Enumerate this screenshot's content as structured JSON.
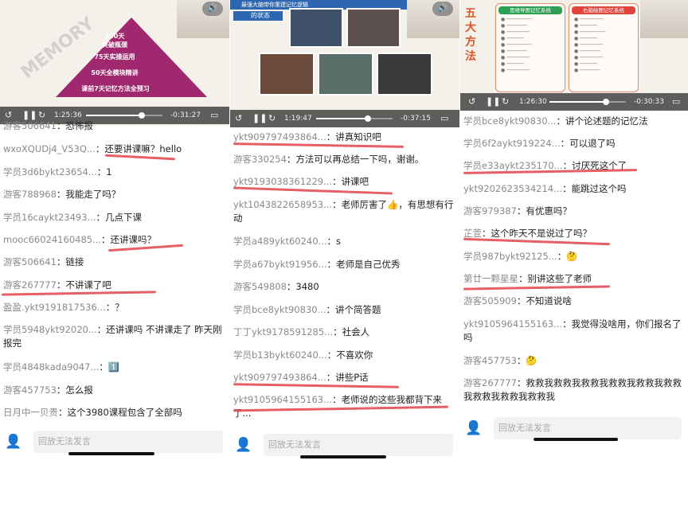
{
  "accent_color": "#e2434b",
  "panels": [
    {
      "video": {
        "elapsed": "1:25:36",
        "remaining": "-0:31:27",
        "progress": 0.73,
        "slide": {
          "word": "MEMORY",
          "steps": [
            "100天 突破瓶颈",
            "75天实操运用",
            "50天全模块精讲",
            "课前7天记忆方法全预习"
          ]
        }
      },
      "messages": [
        {
          "name": "游客506641",
          "text": "恐怖报"
        },
        {
          "name": "wxoXQUDj4_V53Q...",
          "text": "还要讲课嘛？hello"
        },
        {
          "name": "学员3d6bykt23654...",
          "text": "1"
        },
        {
          "name": "游客788968",
          "text": "我能走了吗？"
        },
        {
          "name": "学员16caykt23493...",
          "text": "几点下课"
        },
        {
          "name": "mooc66024160485...",
          "text": "还讲课吗？"
        },
        {
          "name": "游客506641",
          "text": "链接"
        },
        {
          "name": "游客267777",
          "text": "不讲课了吧"
        },
        {
          "name": "盈盈.ykt9191817536...",
          "text": "？"
        },
        {
          "name": "学员5948ykt92020...",
          "text": "还讲课吗 不讲课走了 昨天刚报完"
        },
        {
          "name": "学员4848kada9047...",
          "text": "1️⃣"
        },
        {
          "name": "游客457753",
          "text": "怎么报"
        },
        {
          "name": "日月中一贝贵",
          "text": "这个3980课程包含了全部吗"
        }
      ],
      "input_placeholder": "回放无法发言"
    },
    {
      "video": {
        "elapsed": "1:19:47",
        "remaining": "-0:37:15",
        "progress": 0.68,
        "slide": {
          "title": "最强大脑带你重建记忆逻辑",
          "caption": "的状态"
        }
      },
      "messages": [
        {
          "name": "ykt909797493864...",
          "text": "讲真知识吧"
        },
        {
          "name": "游客330254",
          "text": "方法可以再总结一下吗，谢谢。"
        },
        {
          "name": "ykt9193038361229...",
          "text": "讲课吧"
        },
        {
          "name": "ykt1043822658953...",
          "text": "老师厉害了👍，有思想有行动"
        },
        {
          "name": "学员a489ykt60240...",
          "text": "s"
        },
        {
          "name": "学员a67bykt91956...",
          "text": "老师是自己优秀"
        },
        {
          "name": "游客549808",
          "text": "3480"
        },
        {
          "name": "学员bce8ykt90830...",
          "text": "讲个简答题"
        },
        {
          "name": "丁丁ykt9178591285...",
          "text": "社会人"
        },
        {
          "name": "学员b13bykt60240...",
          "text": "不喜欢你"
        },
        {
          "name": "ykt909797493864...",
          "text": "讲些P话"
        },
        {
          "name": "ykt9105964155163...",
          "text": "老师说的这些我都背下来了..."
        }
      ],
      "input_placeholder": "回放无法发言"
    },
    {
      "video": {
        "elapsed": "1:26:30",
        "remaining": "-0:30:33",
        "progress": 0.74,
        "slide": {
          "side_title": "五大方法",
          "card_a": "思维导图记忆系统",
          "card_b": "右脑绘图记忆系统"
        }
      },
      "messages": [
        {
          "name": "学员bce8ykt90830...",
          "text": "讲个论述题的记忆法"
        },
        {
          "name": "学员6f2aykt919224...",
          "text": "可以退了吗"
        },
        {
          "name": "学员e33aykt235170...",
          "text": "讨厌死这个了"
        },
        {
          "name": "ykt9202623534214...",
          "text": "能跳过这个吗"
        },
        {
          "name": "游客979387",
          "text": "有优惠吗？"
        },
        {
          "name": "芷萱",
          "text": "这个昨天不是说过了吗？"
        },
        {
          "name": "学员987bykt92125...",
          "text": "🤔"
        },
        {
          "name": "第廿一颗星星",
          "text": "别讲这些了老师"
        },
        {
          "name": "游客505909",
          "text": "不知道说啥"
        },
        {
          "name": "ykt9105964155163...",
          "text": "我觉得没啥用，你们报名了吗"
        },
        {
          "name": "游客457753",
          "text": "🤔"
        },
        {
          "name": "游客267777",
          "text": "救救我救救我救救我救救我救救我救救我救救我救救我救救我"
        }
      ],
      "input_placeholder": "回放无法发言"
    }
  ]
}
